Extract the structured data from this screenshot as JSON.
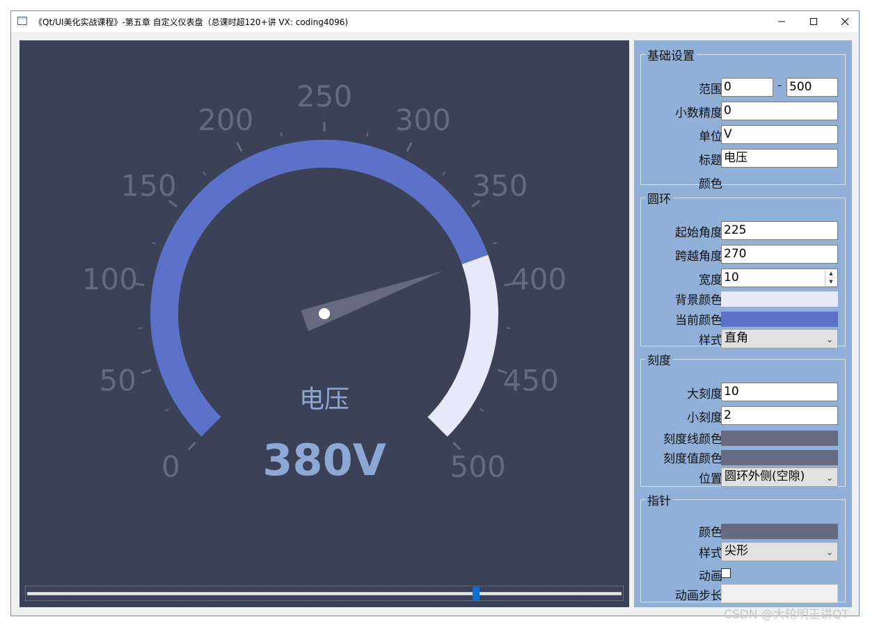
{
  "window": {
    "title": "《Qt/UI美化实战课程》-第五章 自定义仪表盘（总课时超120+讲 VX: coding4096)",
    "minimize_icon": "minimize-icon",
    "maximize_icon": "maximize-icon",
    "close_icon": "close-icon"
  },
  "gauge": {
    "title": "电压",
    "value_text": "380V",
    "value": 380,
    "min": 0,
    "max": 500,
    "start_angle": 225,
    "span_angle": 270,
    "major_labels": [
      "0",
      "50",
      "100",
      "150",
      "200",
      "250",
      "300",
      "350",
      "400",
      "450",
      "500"
    ],
    "colors": {
      "panel_bg": "#3b4157",
      "ring_current": "#5b72c8",
      "ring_background": "#e6e9f7",
      "scale": "#666a80",
      "pointer": "#666a80",
      "title_text": "#8ea8d6",
      "value_text": "#8ea8d6"
    },
    "slider_fraction": 0.76
  },
  "settings": {
    "basic": {
      "legend": "基础设置",
      "range_label": "范围",
      "range_min": "0",
      "range_sep": "-",
      "range_max": "500",
      "precision_label": "小数精度",
      "precision": "0",
      "unit_label": "单位",
      "unit": "V",
      "title_label": "标题",
      "title": "电压",
      "color_label": "颜色"
    },
    "ring": {
      "legend": "圆环",
      "start_label": "起始角度",
      "start": "225",
      "span_label": "跨越角度",
      "span": "270",
      "width_label": "宽度",
      "width": "10",
      "bg_color_label": "背景颜色",
      "bg_color": "#e6e9f7",
      "cur_color_label": "当前颜色",
      "cur_color": "#5b72c8",
      "style_label": "样式",
      "style": "直角"
    },
    "scale": {
      "legend": "刻度",
      "major_label": "大刻度",
      "major": "10",
      "minor_label": "小刻度",
      "minor": "2",
      "line_color_label": "刻度线颜色",
      "line_color": "#666a80",
      "value_color_label": "刻度值颜色",
      "value_color": "#666a80",
      "position_label": "位置",
      "position": "圆环外侧(空隙)"
    },
    "pointer": {
      "legend": "指针",
      "color_label": "颜色",
      "color": "#666a80",
      "style_label": "样式",
      "style": "尖形",
      "anim_label": "动画",
      "anim_checked": false,
      "step_label": "动画步长",
      "step": ""
    }
  },
  "watermark": "CSDN @大轮明王讲QT"
}
